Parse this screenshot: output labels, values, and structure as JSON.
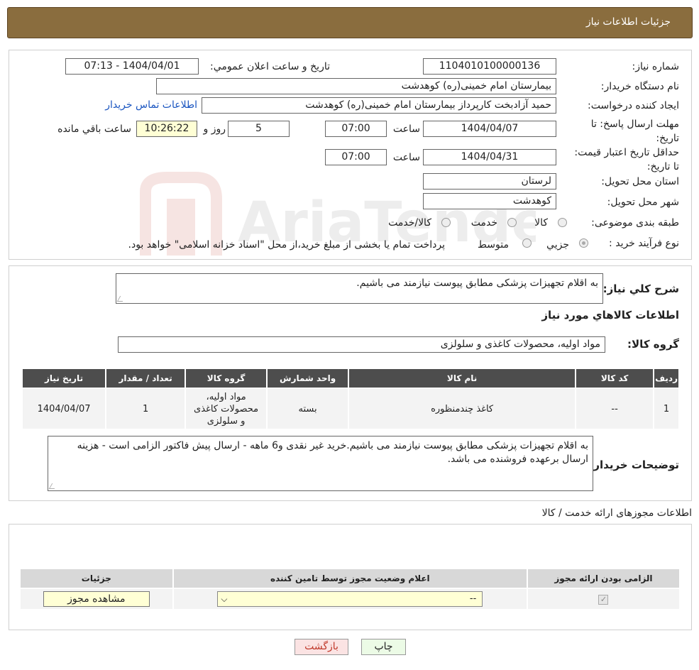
{
  "page": {
    "title": "جزئیات اطلاعات نیاز"
  },
  "form": {
    "need_number_label": "شماره نیاز:",
    "need_number": "1104010100000136",
    "announce_label": "تاریخ و ساعت اعلان عمومي:",
    "announce_value": "1404/04/01 - 07:13",
    "buyer_org_label": "نام دستگاه خريدار:",
    "buyer_org": "بیمارستان امام خمینی(ره) کوهدشت",
    "creator_label": "ایجاد کننده درخواست:",
    "creator": "حمید آزادبخت کارپرداز بیمارستان امام خمینی(ره) کوهدشت",
    "contact_link": "اطلاعات تماس خريدار",
    "deadline_label": "مهلت ارسال پاسخ: تا تاریخ:",
    "deadline_date": "1404/04/07",
    "time_label": "ساعت",
    "deadline_time": "07:00",
    "days_value": "5",
    "days_label": "روز و",
    "remaining_time": "10:26:22",
    "remaining_label": "ساعت باقي مانده",
    "validity_label": "حداقل تاريخ اعتبار قيمت: تا تاریخ:",
    "validity_date": "1404/04/31",
    "validity_time": "07:00",
    "province_label": "استان محل تحویل:",
    "province": "لرستان",
    "city_label": "شهر محل تحویل:",
    "city": "کوهدشت",
    "category_label": "طبقه بندی موضوعی:",
    "category_options": [
      "کالا",
      "خدمت",
      "کالا/خدمت"
    ],
    "process_label": "نوع فرآیند خرید :",
    "process_options": [
      "جزيي",
      "متوسط"
    ],
    "process_note": "پرداخت تمام یا بخشی از مبلغ خرید،از محل \"اسناد خزانه اسلامی\" خواهد بود."
  },
  "summary": {
    "label": "شرح كلي نياز:",
    "text": "به اقلام تجهیزات پزشکی مطابق پیوست نیازمند می باشیم.",
    "goods_info_title": "اطلاعات كالاهاي مورد نياز",
    "goods_group_label": "گروه کالا:",
    "goods_group": "مواد اولیه، محصولات کاغذی و سلولزی"
  },
  "items_table": {
    "headers": [
      "رديف",
      "كد كالا",
      "نام كالا",
      "واحد شمارش",
      "گروه كالا",
      "تعداد / مقدار",
      "تاريخ نياز"
    ],
    "rows": [
      {
        "row": "1",
        "code": "--",
        "name": "کاغذ چندمنظوره",
        "unit": "بسته",
        "group": "مواد اولیه، محصولات کاغذی و سلولزی",
        "qty": "1",
        "date": "1404/04/07"
      }
    ]
  },
  "buyer_notes": {
    "label": "توضيحات خريدار:",
    "text": "به اقلام تجهیزات پزشکی مطابق پیوست نیازمند می باشیم.خرید غیر نقدی و6 ماهه - ارسال پیش فاکتور الزامی است - هزینه ارسال برعهده فروشنده می باشد."
  },
  "permits": {
    "title": "اطلاعات مجوزهای ارائه خدمت / کالا",
    "headers": [
      "الزامی بودن ارائه مجوز",
      "اعلام وضعیت مجوز توسط تامین کننده",
      "جزئیات"
    ],
    "select_value": "--",
    "view_button": "مشاهده مجوز"
  },
  "actions": {
    "print": "چاپ",
    "back": "بازگشت"
  },
  "watermark": "AriaTender.neT"
}
